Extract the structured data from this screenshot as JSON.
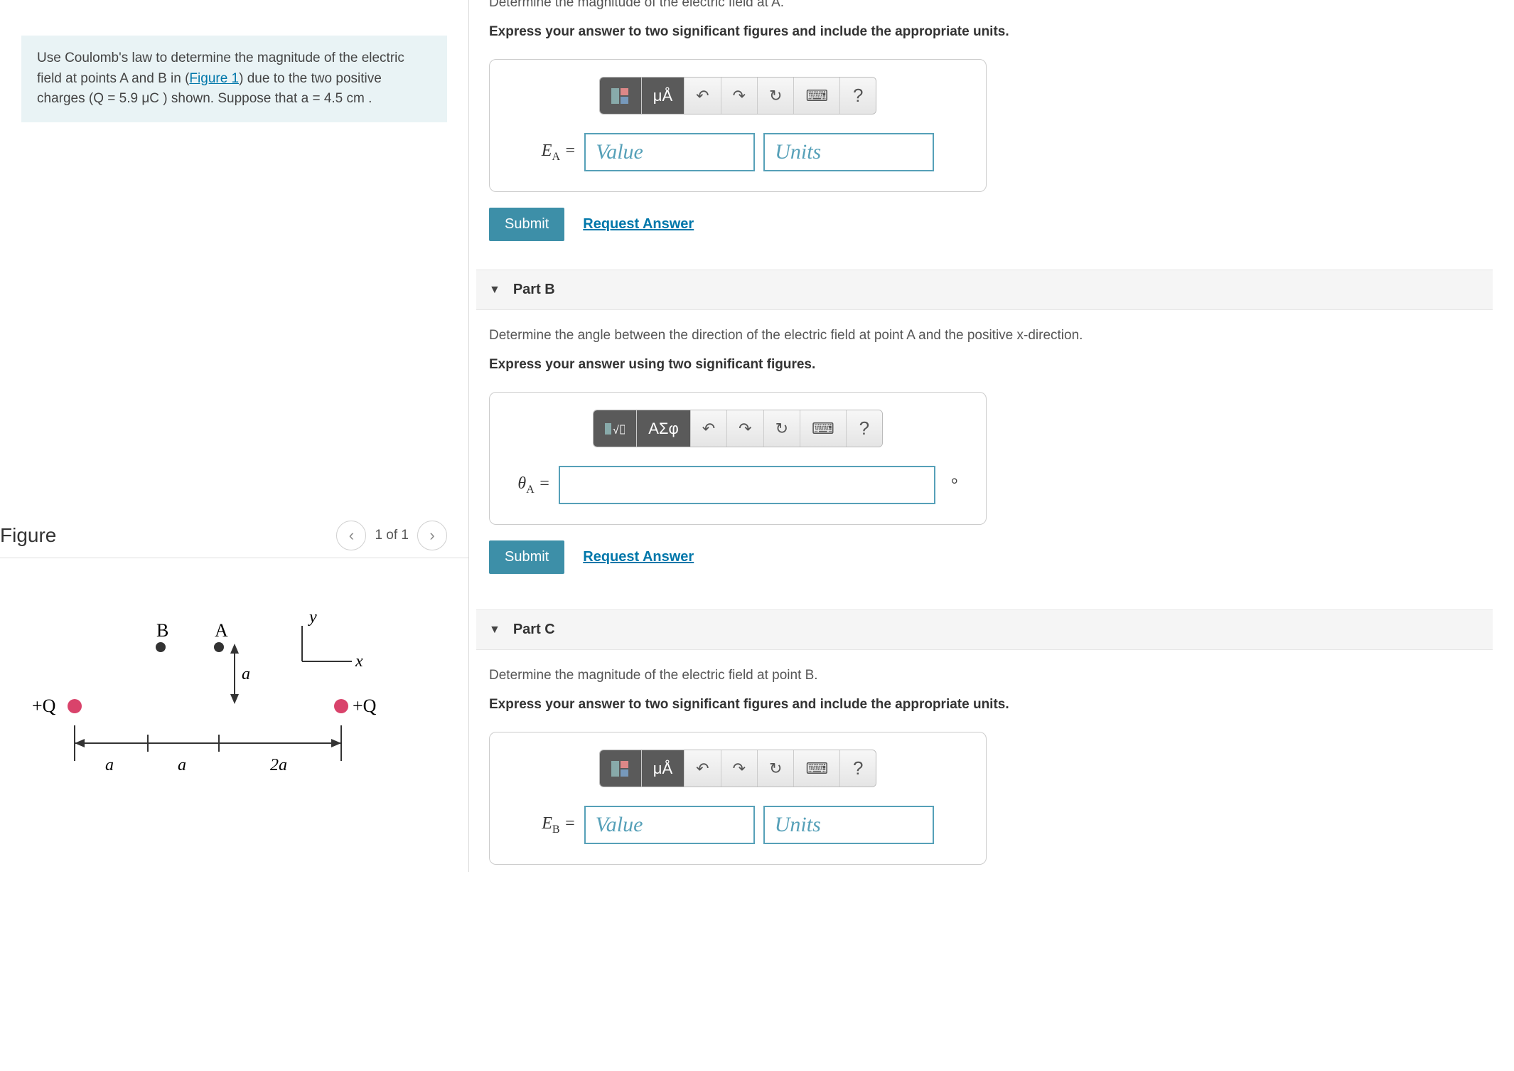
{
  "problem": {
    "text_prefix": "Use Coulomb's law to determine the magnitude of the electric field at points A and B in (",
    "figure_link": "Figure 1",
    "text_suffix": ") due to the two positive charges (Q = 5.9 μC ) shown. Suppose that a = 4.5  cm ."
  },
  "figure": {
    "title": "Figure",
    "pager": "1 of 1",
    "labels": {
      "B": "B",
      "A": "A",
      "y": "y",
      "x": "x",
      "a": "a",
      "plusQ": "+Q",
      "twoa": "2a"
    }
  },
  "parts": {
    "A": {
      "topline": "Determine the magnitude of the electric field at A.",
      "q": "Express your answer to two significant figures and include the appropriate units.",
      "var": "E",
      "sub": "A",
      "val_ph": "Value",
      "unit_ph": "Units",
      "tb": {
        "fmt": "▭",
        "unit": "μÅ"
      }
    },
    "B": {
      "header": "Part B",
      "p1": "Determine the angle between the direction of the electric field at point A and the positive x-direction.",
      "q": "Express your answer using two significant figures.",
      "var": "θ",
      "sub": "A",
      "degree": "°",
      "tb": {
        "fmt": "√▭",
        "greek": "ΑΣφ"
      }
    },
    "C": {
      "header": "Part C",
      "p1": "Determine the magnitude of the electric field at point B.",
      "q": "Express your answer to two significant figures and include the appropriate units.",
      "var": "E",
      "sub": "B",
      "val_ph": "Value",
      "unit_ph": "Units",
      "tb": {
        "fmt": "▭",
        "unit": "μÅ"
      }
    }
  },
  "common": {
    "submit": "Submit",
    "request": "Request Answer",
    "undo": "↶",
    "redo": "↷",
    "reset": "↻",
    "keyboard": "⌨",
    "help": "?"
  }
}
